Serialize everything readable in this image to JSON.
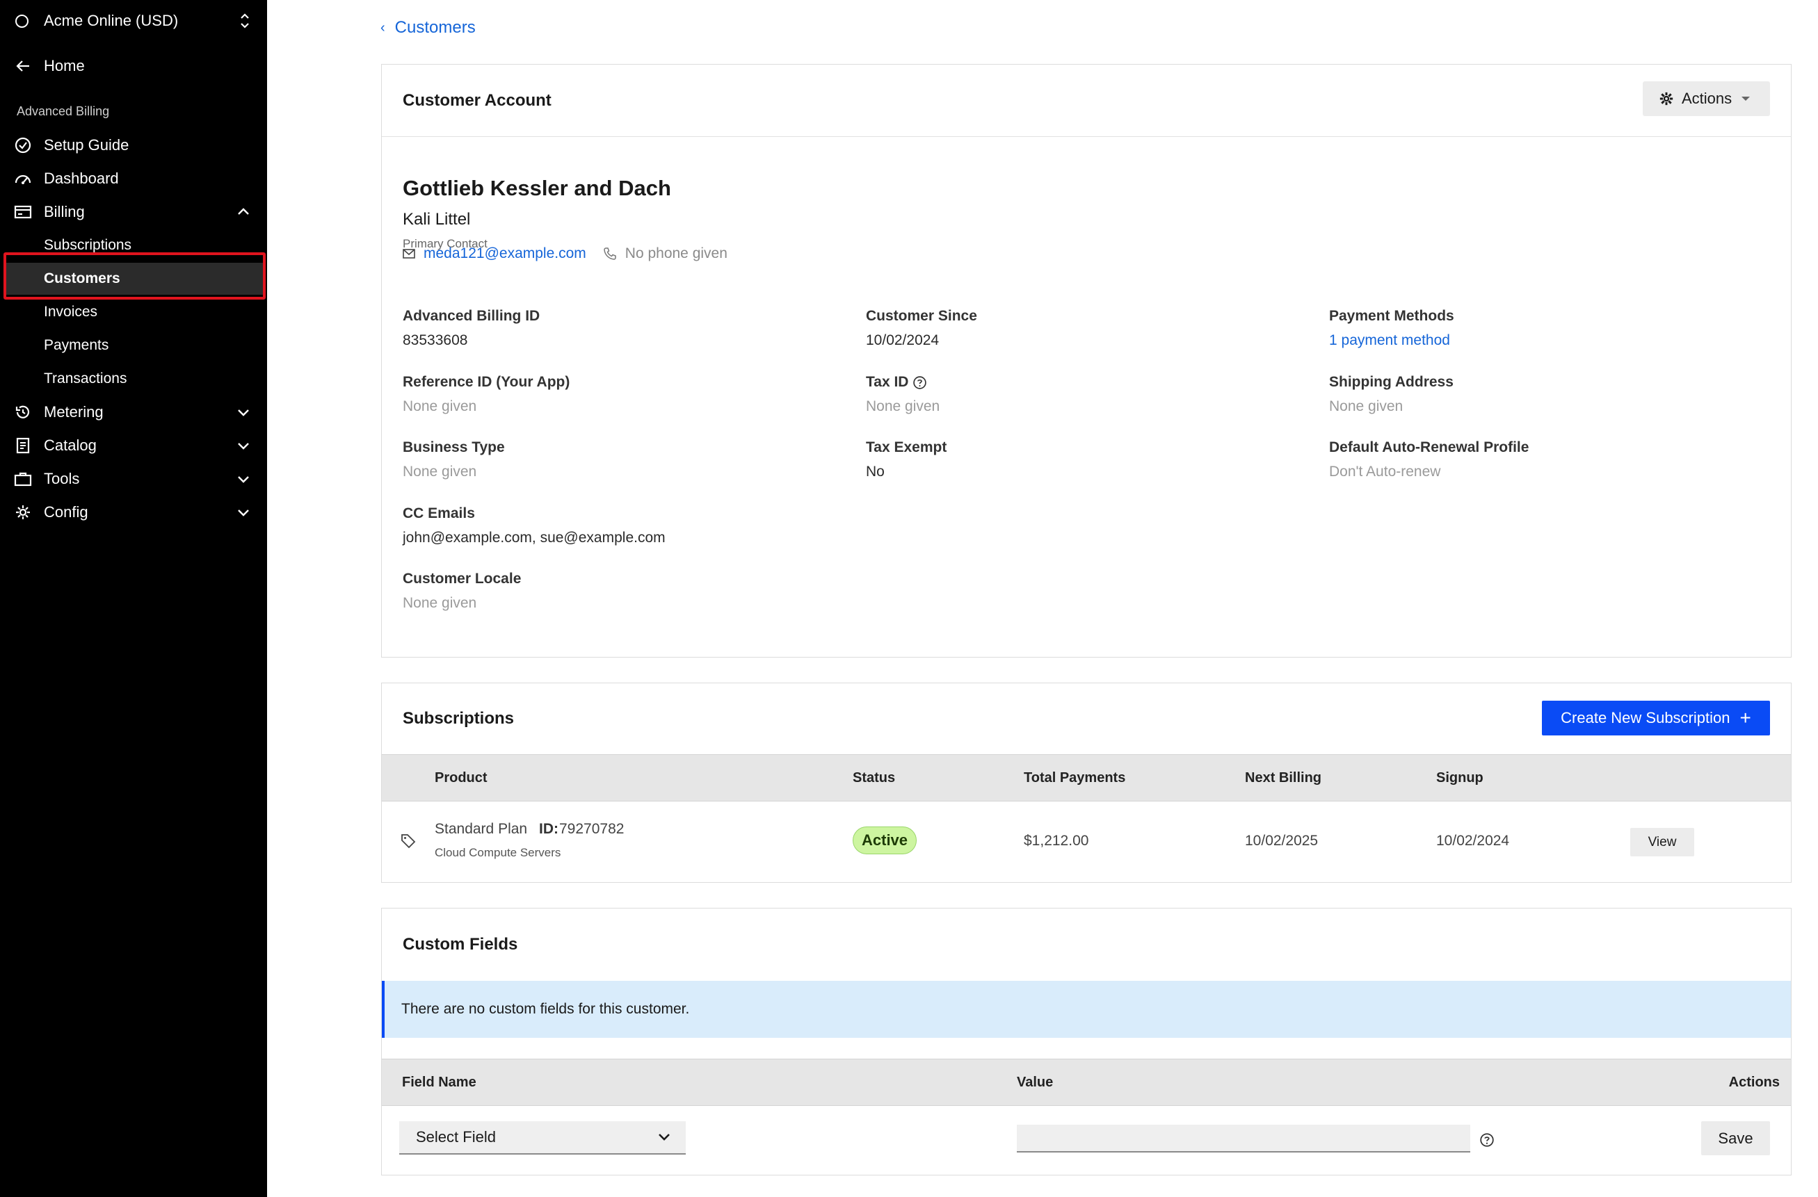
{
  "sidebar": {
    "org_name": "Acme Online (USD)",
    "home_label": "Home",
    "section_label": "Advanced Billing",
    "items": [
      {
        "label": "Setup Guide",
        "icon": "check-circle-icon"
      },
      {
        "label": "Dashboard",
        "icon": "gauge-icon"
      },
      {
        "label": "Billing",
        "icon": "billing-card-icon",
        "expanded": true
      },
      {
        "label": "Metering",
        "icon": "history-icon",
        "expanded": false
      },
      {
        "label": "Catalog",
        "icon": "document-list-icon",
        "expanded": false
      },
      {
        "label": "Tools",
        "icon": "briefcase-icon",
        "expanded": false
      },
      {
        "label": "Config",
        "icon": "gear-icon",
        "expanded": false
      }
    ],
    "billing_children": [
      "Subscriptions",
      "Customers",
      "Invoices",
      "Payments",
      "Transactions"
    ],
    "active_item": "Customers",
    "highlight_color": "#e0141e"
  },
  "breadcrumb": {
    "label": "Customers"
  },
  "account": {
    "header_title": "Customer Account",
    "actions_label": "Actions",
    "customer_name": "Gottlieb Kessler and Dach",
    "contact_name": "Kali Littel",
    "contact_role": "Primary Contact",
    "email": "meda121@example.com",
    "phone": "No phone given",
    "fields": {
      "billing_id": {
        "label": "Advanced Billing ID",
        "value": "83533608"
      },
      "customer_since": {
        "label": "Customer Since",
        "value": "10/02/2024"
      },
      "payment_methods": {
        "label": "Payment Methods",
        "value": "1 payment method"
      },
      "reference_id": {
        "label": "Reference ID (Your App)",
        "value": "None given"
      },
      "tax_id": {
        "label": "Tax ID",
        "value": "None given"
      },
      "shipping_address": {
        "label": "Shipping Address",
        "value": "None given"
      },
      "business_type": {
        "label": "Business Type",
        "value": "None given"
      },
      "tax_exempt": {
        "label": "Tax Exempt",
        "value": "No"
      },
      "auto_renewal": {
        "label": "Default Auto-Renewal Profile",
        "value": "Don't Auto-renew"
      },
      "cc_emails": {
        "label": "CC Emails",
        "value": "john@example.com, sue@example.com"
      },
      "locale": {
        "label": "Customer Locale",
        "value": "None given"
      }
    }
  },
  "subscriptions": {
    "title": "Subscriptions",
    "create_label": "Create New Subscription",
    "columns": [
      "Product",
      "Status",
      "Total Payments",
      "Next Billing",
      "Signup"
    ],
    "rows": [
      {
        "product": "Standard Plan",
        "id_label": "ID:",
        "id": "79270782",
        "product_family": "Cloud Compute Servers",
        "status": "Active",
        "total_payments": "$1,212.00",
        "next_billing": "10/02/2025",
        "signup": "10/02/2024",
        "view_label": "View"
      }
    ],
    "status_color": "#cdf5a0"
  },
  "custom_fields": {
    "title": "Custom Fields",
    "info_message": "There are no custom fields for this customer.",
    "columns": [
      "Field Name",
      "Value",
      "Actions"
    ],
    "select_value": "Select Field",
    "value_input": "",
    "save_label": "Save"
  },
  "colors": {
    "primary": "#0a4bf5",
    "link": "#1565d8",
    "sidebar_bg": "#000000",
    "info_bg": "#d9ecfb"
  }
}
